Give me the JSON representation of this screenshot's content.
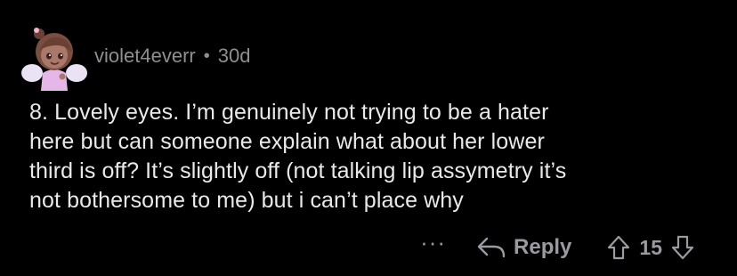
{
  "comment": {
    "username": "violet4everr",
    "separator": "•",
    "age": "30d",
    "body_lines": [
      "8. Lovely eyes. I’m genuinely not trying to be a hater",
      "here but can someone explain what about her lower",
      "third is off? It’s slightly off (not talking lip assymetry it’s",
      "not bothersome to me) but i can’t place why"
    ]
  },
  "actions": {
    "more_label": "···",
    "reply_label": "Reply",
    "vote_count": "15"
  },
  "icons": {
    "avatar": "avatar-icon",
    "reply": "reply-arrow-icon",
    "upvote": "upvote-arrow-icon",
    "downvote": "downvote-arrow-icon"
  },
  "colors": {
    "background": "#000000",
    "text_primary": "#e9e9ea",
    "text_secondary": "#8e8e93"
  }
}
